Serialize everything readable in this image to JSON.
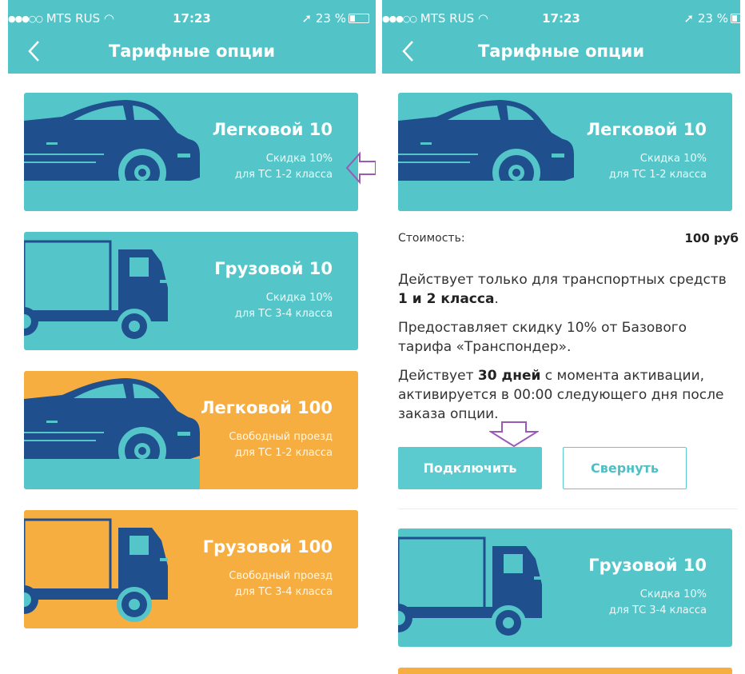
{
  "status_bar": {
    "carrier": "MTS RUS",
    "time": "17:23",
    "battery": "23 %"
  },
  "nav": {
    "title": "Тарифные опции"
  },
  "tariffs": [
    {
      "title": "Легковой 10",
      "line1": "Скидка 10%",
      "line2": "для ТС 1-2 класса",
      "color": "#54c6ca",
      "vehicle": "car"
    },
    {
      "title": "Грузовой 10",
      "line1": "Скидка 10%",
      "line2": "для ТС 3-4 класса",
      "color": "#54c6ca",
      "vehicle": "truck"
    },
    {
      "title": "Легковой 100",
      "line1": "Свободный проезд",
      "line2": "для ТС 1-2 класса",
      "color": "#f7ae41",
      "vehicle": "car"
    },
    {
      "title": "Грузовой 100",
      "line1": "Свободный проезд",
      "line2": "для ТС 3-4 класса",
      "color": "#f7ae41",
      "vehicle": "truck"
    }
  ],
  "details": {
    "cost_label": "Стоимость:",
    "cost_value": "100 руб",
    "para1_text": "Действует только для транспортных средств",
    "para1_bold": "1 и 2 класса",
    "para1_end": ".",
    "para2": "Предоставляет скидку 10% от Базового тарифа «Транспондер».",
    "para3_start": "Действует",
    "para3_bold": "30 дней",
    "para3_rest": "с момента активации, активируется в 00:00 следующего дня после заказа опции.",
    "connect_label": "Подключить",
    "collapse_label": "Свернуть"
  },
  "colors": {
    "header": "#52c4c8",
    "teal_card": "#54c6ca",
    "orange_card": "#f7ae41",
    "vehicle": "#1f4f8c",
    "annotation_arrow": "#9b59b6"
  }
}
